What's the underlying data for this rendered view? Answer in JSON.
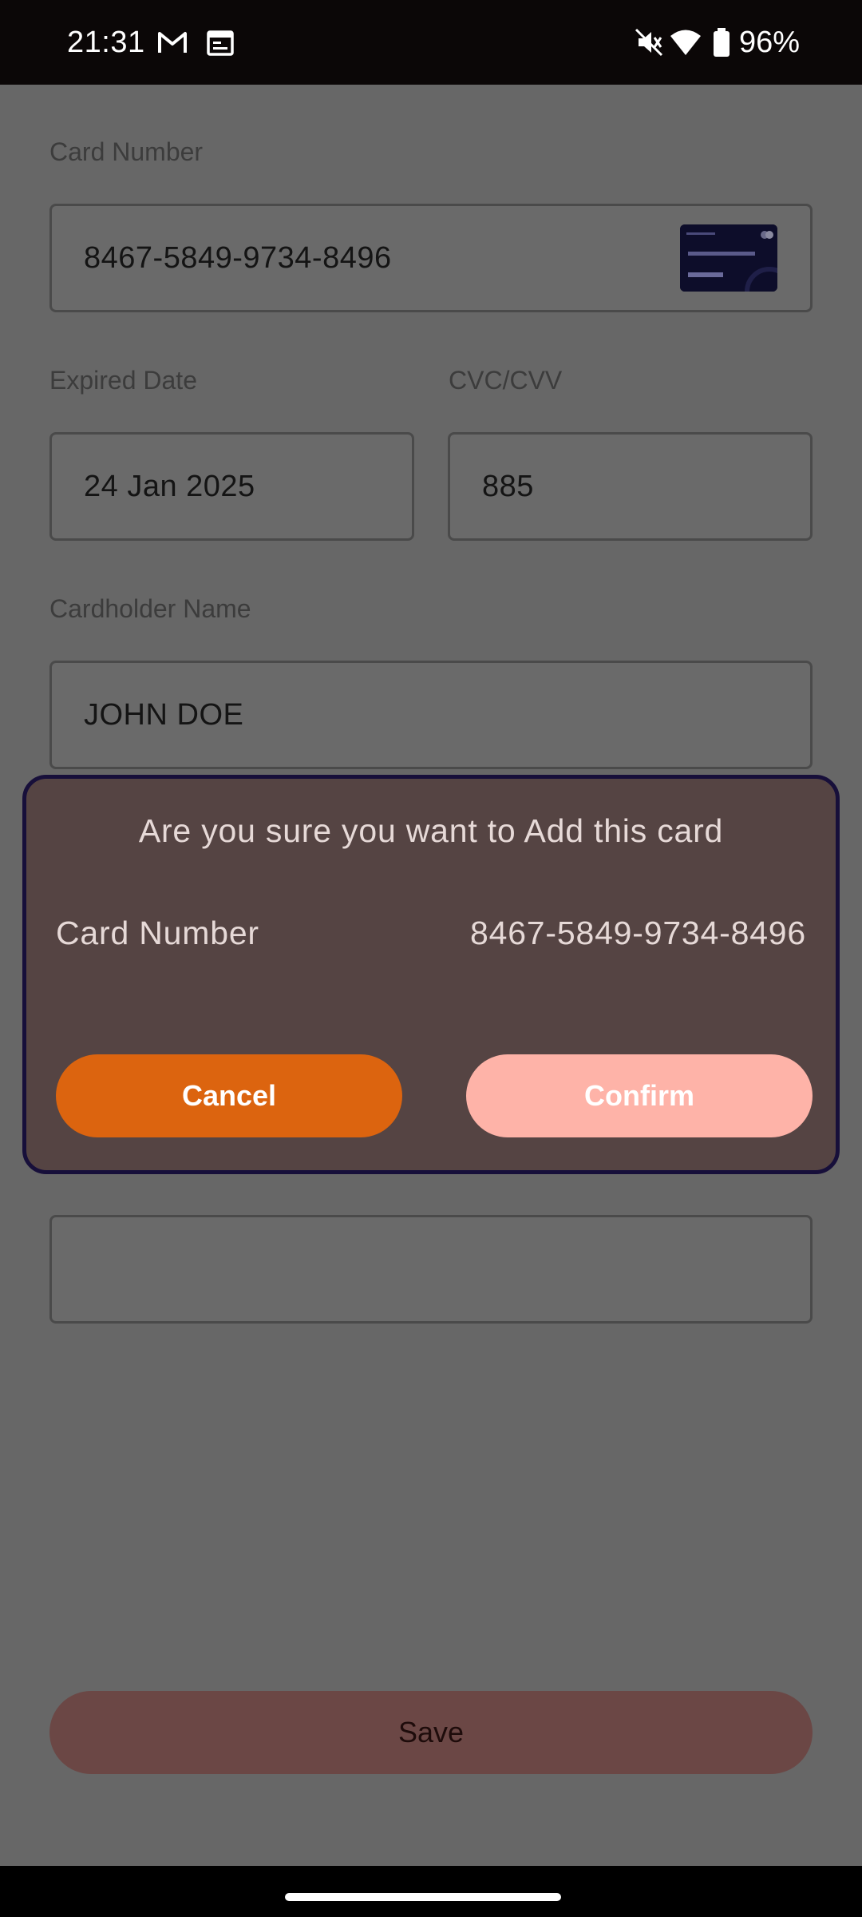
{
  "status_bar": {
    "time": "21:31",
    "battery": "96%",
    "icons": [
      "gmail-icon",
      "calendar-icon",
      "mute-icon",
      "wifi-icon",
      "battery-icon"
    ]
  },
  "form": {
    "card_number_label": "Card Number",
    "card_number_value": "8467-5849-9734-8496",
    "expired_label": "Expired Date",
    "expired_value": "24 Jan 2025",
    "cvc_label": "CVC/CVV",
    "cvc_value": "885",
    "holder_label": "Cardholder Name",
    "holder_value": "JOHN DOE",
    "extra_field_value": "",
    "save_label": "Save"
  },
  "dialog": {
    "title": "Are you sure you want to Add this card",
    "card_label": "Card Number",
    "card_value": "8467-5849-9734-8496",
    "cancel_label": "Cancel",
    "confirm_label": "Confirm"
  },
  "colors": {
    "cancel": "#dc640f",
    "confirm": "#feb3a8",
    "dialog_bg": "#554443",
    "save": "#6b4745"
  }
}
